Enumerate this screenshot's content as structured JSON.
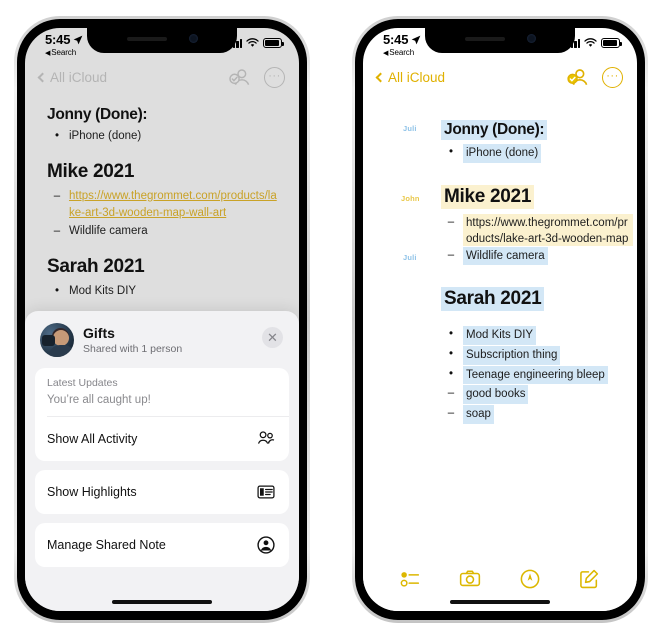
{
  "status_bar": {
    "time": "5:45",
    "back_label": "Search",
    "location_icon": "location-arrow-icon",
    "signal_icon": "cellular-bars-icon",
    "wifi_icon": "wifi-icon",
    "battery_icon": "battery-icon"
  },
  "nav": {
    "back_label": "All iCloud",
    "collab_icon": "collaboration-person-icon",
    "more_icon": "more-ellipsis-icon",
    "more_glyph": "···"
  },
  "note": {
    "sections": [
      {
        "heading": "Jonny (Done):",
        "heading_size": "small",
        "heading_highlight": "blue",
        "author_tag": "Juli",
        "author_tag_color": "blue",
        "items": [
          {
            "marker": "•",
            "text": "iPhone (done)",
            "highlight": "blue",
            "link": false
          }
        ]
      },
      {
        "heading": "Mike 2021",
        "heading_size": "big",
        "heading_highlight": "yellow",
        "author_tag": "John",
        "author_tag_color": "yellow",
        "items": [
          {
            "marker": "–",
            "text": "https://www.thegrommet.com/products/lake-art-3d-wooden-map-wall-art",
            "highlight": "yellow",
            "link": true
          },
          {
            "marker": "–",
            "text": "Wildlife camera",
            "highlight": "blue",
            "link": false,
            "author_tag": "Juli"
          }
        ]
      },
      {
        "heading": "Sarah 2021",
        "heading_size": "big",
        "heading_highlight": "blue",
        "items": [
          {
            "marker": "•",
            "text": "Mod Kits DIY",
            "highlight": "blue",
            "link": false
          },
          {
            "marker": "•",
            "text": "Subscription thing",
            "highlight": "blue",
            "link": false
          },
          {
            "marker": "•",
            "text": "Teenage engineering bleep",
            "highlight": "blue",
            "link": false
          },
          {
            "marker": "–",
            "text": "good books",
            "highlight": "blue",
            "link": false
          },
          {
            "marker": "–",
            "text": "soap",
            "highlight": "blue",
            "link": false
          }
        ]
      }
    ]
  },
  "share_sheet": {
    "title": "Gifts",
    "subtitle": "Shared with 1 person",
    "close_label": "✕",
    "avatar_icon": "contact-photo-avatar",
    "updates_label": "Latest Updates",
    "updates_value": "You’re all caught up!",
    "rows": [
      {
        "label": "Show All Activity",
        "icon": "two-people-icon"
      },
      {
        "label": "Show Highlights",
        "icon": "highlights-card-icon"
      },
      {
        "label": "Manage Shared Note",
        "icon": "person-circle-icon"
      }
    ]
  },
  "toolbar": {
    "items": [
      {
        "name": "checklist-icon",
        "label": "Checklist"
      },
      {
        "name": "camera-icon",
        "label": "Camera"
      },
      {
        "name": "markup-pen-icon",
        "label": "Markup"
      },
      {
        "name": "compose-icon",
        "label": "New Note"
      }
    ]
  },
  "colors": {
    "accent_yellow": "#e0b100",
    "highlight_blue": "#d3e7f6",
    "highlight_yellow": "#fbf1cf",
    "tag_blue": "#8fc3e8",
    "tag_yellow": "#e9c84a",
    "screen_gray": "#dedede",
    "link": "#c9a227"
  }
}
